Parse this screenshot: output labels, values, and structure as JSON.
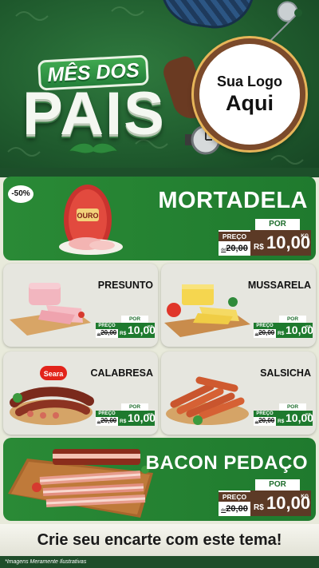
{
  "header": {
    "title_line1": "MÊS DOS",
    "title_line2": "PAIS",
    "logo_placeholder": {
      "line1": "Sua Logo",
      "line2": "Aqui"
    }
  },
  "featured_top": {
    "name": "MORTADELA",
    "discount_badge": "-50%",
    "brand_label": "OURO",
    "price": {
      "por_label": "POR",
      "preco_label": "PREÇO",
      "old_prefix": "de",
      "old_value": "20,00",
      "currency": "R$",
      "value": "10,00",
      "unit": "KG"
    }
  },
  "products": [
    {
      "name": "PRESUNTO",
      "price": {
        "por_label": "POR",
        "preco_label": "PREÇO",
        "old_prefix": "de",
        "old_value": "20,00",
        "currency": "R$",
        "value": "10,00",
        "unit": "KG"
      }
    },
    {
      "name": "MUSSARELA",
      "price": {
        "por_label": "POR",
        "preco_label": "PREÇO",
        "old_prefix": "de",
        "old_value": "20,00",
        "currency": "R$",
        "value": "10,00",
        "unit": "KG"
      }
    },
    {
      "name": "CALABRESA",
      "brand_label": "Seara",
      "price": {
        "por_label": "POR",
        "preco_label": "PREÇO",
        "old_prefix": "de",
        "old_value": "20,00",
        "currency": "R$",
        "value": "10,00",
        "unit": "KG"
      }
    },
    {
      "name": "SALSICHA",
      "price": {
        "por_label": "POR",
        "preco_label": "PREÇO",
        "old_prefix": "de",
        "old_value": "20,00",
        "currency": "R$",
        "value": "10,00",
        "unit": "KG"
      }
    }
  ],
  "featured_bottom": {
    "name": "BACON PEDAÇO",
    "price": {
      "por_label": "POR",
      "preco_label": "PREÇO",
      "old_prefix": "de",
      "old_value": "20,00",
      "currency": "R$",
      "value": "10,00",
      "unit": "KG"
    }
  },
  "footer": {
    "cta": "Crie seu encarte com este tema!",
    "disclaimer": "*Imagens Meramente Ilustrativas"
  },
  "colors": {
    "header_green": "#1f5a2d",
    "card_green": "#2a8a36",
    "price_brown": "#5c3a26",
    "price_green": "#1e7a2e",
    "logo_ring": "#7b4a2b",
    "body_background": "#e8eadb"
  },
  "icons": [
    "tie-icon",
    "wrench-icon",
    "watch-icon",
    "mustache-icon",
    "shoe-icon"
  ]
}
